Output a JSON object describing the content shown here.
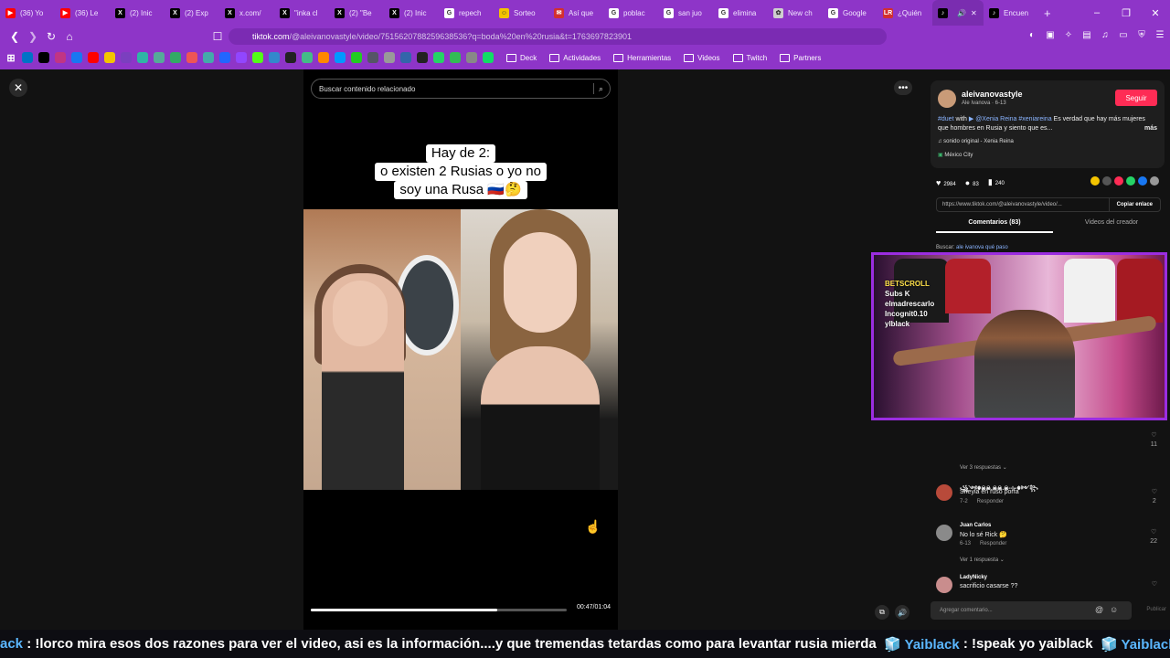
{
  "browser": {
    "tabs": [
      {
        "title": "(36) Yo",
        "icon": "youtube-icon",
        "color": "#ff0000"
      },
      {
        "title": "(36) Le",
        "icon": "youtube-icon",
        "color": "#ff0000"
      },
      {
        "title": "(2) Inic",
        "icon": "x-icon",
        "color": "#000000"
      },
      {
        "title": "(2) Exp",
        "icon": "x-icon",
        "color": "#000000"
      },
      {
        "title": "x.com/",
        "icon": "x-icon",
        "color": "#000000"
      },
      {
        "title": "\"inka cl",
        "icon": "x-icon",
        "color": "#000000"
      },
      {
        "title": "(2) \"Be",
        "icon": "x-icon",
        "color": "#000000"
      },
      {
        "title": "(2) Inic",
        "icon": "x-icon",
        "color": "#000000"
      },
      {
        "title": "repech",
        "icon": "google-icon",
        "color": "#ffffff"
      },
      {
        "title": "Sorteo",
        "icon": "emoji-icon",
        "color": "#f4c400"
      },
      {
        "title": "Así que",
        "icon": "flag-icon",
        "color": "#d32f2f"
      },
      {
        "title": "poblac",
        "icon": "google-icon",
        "color": "#ffffff"
      },
      {
        "title": "san juo",
        "icon": "google-icon",
        "color": "#ffffff"
      },
      {
        "title": "elimina",
        "icon": "google-icon",
        "color": "#ffffff"
      },
      {
        "title": "New ch",
        "icon": "chat-icon",
        "color": "#cfcfcf"
      },
      {
        "title": "Google",
        "icon": "google-icon",
        "color": "#ffffff"
      },
      {
        "title": "¿Quién",
        "icon": "lr-icon",
        "color": "#d32f2f"
      },
      {
        "title": "",
        "icon": "tiktok-icon",
        "color": "#000000",
        "active": true
      },
      {
        "title": "Encuen",
        "icon": "tiktok-icon",
        "color": "#000000"
      }
    ],
    "new_tab": "+",
    "url_main": "tiktok.com",
    "url_rest": "/@aleivanovastyle/video/7515620788259638536?q=boda%20en%20rusia&t=1763697823901",
    "bookmarks": {
      "icons": [
        "outlook-icon",
        "tiktok-icon",
        "instagram-icon",
        "facebook-icon",
        "youtube-icon",
        "app-icon",
        "app-icon",
        "app-icon",
        "app-icon",
        "app-icon",
        "app-icon",
        "app-icon",
        "app-icon",
        "twitch-icon",
        "kick-icon",
        "app-icon",
        "app-icon",
        "app-icon",
        "app-icon",
        "app-icon",
        "app-icon",
        "app-icon",
        "app-icon",
        "app-icon",
        "app-icon",
        "whatsapp-icon",
        "app-icon",
        "app-icon",
        "app-icon"
      ],
      "folders": [
        "Deck",
        "Actividades",
        "Herramientas",
        "Videos",
        "Twitch",
        "Partners"
      ]
    },
    "accent": "#8e35c8"
  },
  "video": {
    "search_placeholder": "Buscar contenido relacionado",
    "caption_lines": [
      "Hay de 2:",
      "o existen 2 Rusias o yo no",
      "soy una Rusa 🇷🇺🤔"
    ],
    "time": "00:47/01:04",
    "progress": 0.73
  },
  "panel": {
    "username": "aleivanovastyle",
    "display": "Ale Ivanova · 6-13",
    "follow": "Seguir",
    "desc_tag1": "#duet",
    "desc_with": " with ",
    "desc_mention": "▶ @Xenia Reina",
    "desc_tag2": " #xeniareina",
    "desc_text": " Es verdad que hay más mujeres que hombres en Rusia y siento que es...",
    "desc_more": "más",
    "music": "♫ sonido original - Xenia Reina",
    "location": "México City",
    "likes": "2984",
    "comments": "83",
    "saves": "240",
    "link": "https://www.tiktok.com/@aleivanovastyle/video/...",
    "copy": "Copiar enlace",
    "tab_comments": "Comentarios (83)",
    "tab_videos": "Videos del creador",
    "related_prefix": "Buscar: ",
    "related_query": "ale ivanova qué paso",
    "comments_list": [
      {
        "name": "",
        "text": "",
        "meta": "",
        "reply": "",
        "likes": "11"
      },
      {
        "name": "꧁༺☬☠☠.☠☠.☠-⊹-☬༻꧂",
        "text": "Sheyla en ruso porfa",
        "meta": "7-2",
        "reply": "Responder",
        "likes": "2"
      },
      {
        "name": "Juan Carlos",
        "text": "No lo sé Rick 🤔",
        "meta": "6-13",
        "reply": "Responder",
        "likes": "22"
      },
      {
        "name": "LadyNicky",
        "text": "sacrificio casarse ??",
        "meta": "",
        "reply": "",
        "likes": ""
      }
    ],
    "replies_1": "Ver 3 respuestas ⌄",
    "replies_2": "Ver 1 respuesta ⌄",
    "composer_placeholder": "Agregar comentario...",
    "publish": "Publicar"
  },
  "overlay": {
    "brand": "BETSCROLL",
    "line1": "Subs K",
    "line2": "elmadrescarlo",
    "line3": "Incognit0.10",
    "line4": "ylblack"
  },
  "ticker": {
    "lead": "ack",
    "msg1": " : !lorco mira esos dos razones para ver el video, asi es la información....y que tremendas tetardas como para levantar rusia mierda  ",
    "user1": "🧊 Yaiblack",
    "msg2": " : !speak yo yaiblack  ",
    "user2": "🧊 Yaiblack",
    "msg3": " : 🌍"
  }
}
